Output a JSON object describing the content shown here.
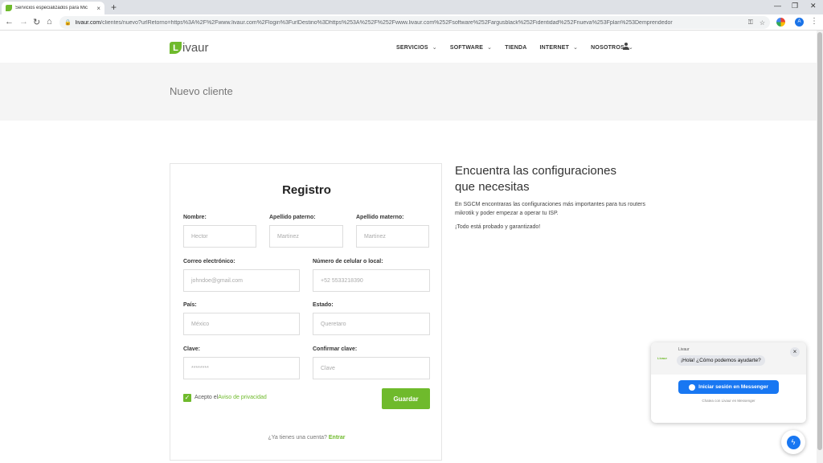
{
  "browser": {
    "tab_title": "Servicios especializados para Mic",
    "tab_close": "×",
    "new_tab": "+",
    "url_domain": "livaur.com",
    "url_path": "/clientes/nuevo?urlRetorno=https%3A%2F%2Fwww.livaur.com%2Flogin%3FurlDestino%3Dhttps%253A%252F%252Fwww.livaur.com%252Fsoftware%252Fargusblack%252Fidentidad%252Fnueva%253Fplan%253Demprendedor",
    "profile_initial": "A"
  },
  "header": {
    "logo_mark": "L",
    "logo_text": "ivaur",
    "menu": [
      {
        "label": "SERVICIOS",
        "has_dropdown": true
      },
      {
        "label": "SOFTWARE",
        "has_dropdown": true
      },
      {
        "label": "TIENDA",
        "has_dropdown": false
      },
      {
        "label": "INTERNET",
        "has_dropdown": true
      },
      {
        "label": "NOSOTROS",
        "has_dropdown": true
      }
    ]
  },
  "banner": {
    "title": "Nuevo cliente"
  },
  "form": {
    "title": "Registro",
    "fields": {
      "nombre": {
        "label": "Nombre:",
        "placeholder": "Hector"
      },
      "apellido_paterno": {
        "label": "Apellido paterno:",
        "placeholder": "Martinez"
      },
      "apellido_materno": {
        "label": "Apellido materno:",
        "placeholder": "Martinez"
      },
      "correo": {
        "label": "Correo electrónico:",
        "placeholder": "johndoe@gmail.com"
      },
      "celular": {
        "label": "Número de celular o local:",
        "placeholder": "+52 5533218390"
      },
      "pais": {
        "label": "País:",
        "placeholder": "México"
      },
      "estado": {
        "label": "Estado:",
        "placeholder": "Queretaro"
      },
      "clave": {
        "label": "Clave:",
        "placeholder": "********"
      },
      "confirmar": {
        "label": "Confirmar clave:",
        "placeholder": "Clave"
      }
    },
    "privacy_prefix": "Acepto el",
    "privacy_link": "Aviso de privacidad",
    "privacy_checked": true,
    "submit_label": "Guardar",
    "login_prompt": "¿Ya tienes una cuenta?",
    "login_link": "Entrar"
  },
  "info": {
    "title": "Encuentra las configuraciones que necesitas",
    "paragraph1": "En SGCM encontraras las configuraciones más importantes para tus routers mikrotik y poder empezar a operar tu ISP.",
    "paragraph2": "¡Todo está probado y garantizado!"
  },
  "chat": {
    "page_name": "Livaur",
    "avatar_text": "Livaur",
    "greeting": "¡Hola! ¿Cómo podemos ayudarte?",
    "button_label": "Iniciar sesión en Messenger",
    "footer": "Chatea con Livaur en Messenger",
    "close": "×"
  },
  "colors": {
    "brand_green": "#6fba2c",
    "messenger_blue": "#1877f2"
  }
}
